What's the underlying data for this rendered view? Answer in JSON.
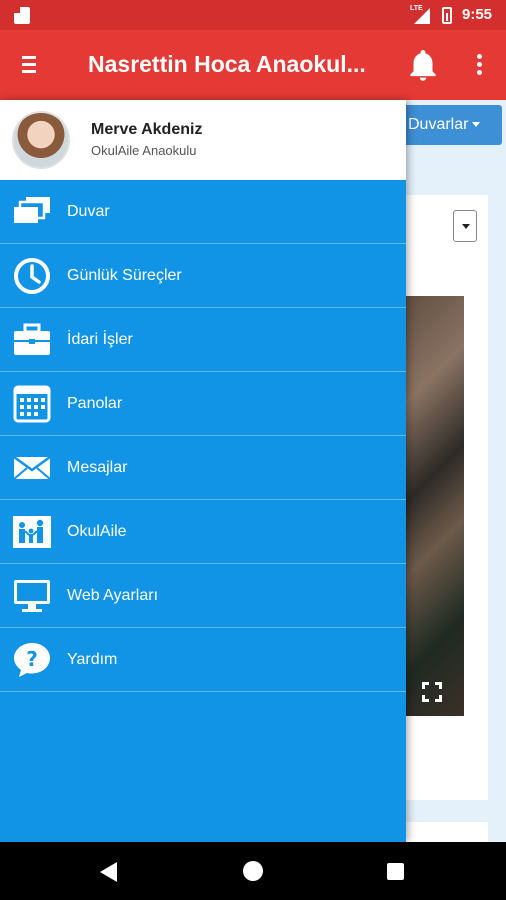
{
  "status_bar": {
    "network": "LTE",
    "time": "9:55"
  },
  "app_bar": {
    "title": "Nasrettin Hoca Anaokul..."
  },
  "content": {
    "walls_button_label": "Duvarlar"
  },
  "drawer": {
    "user_name": "Merve Akdeniz",
    "user_school": "OkulAile Anaokulu",
    "items": [
      {
        "label": "Duvar",
        "icon": "layers-icon"
      },
      {
        "label": "Günlük Süreçler",
        "icon": "clock-icon"
      },
      {
        "label": "İdari İşler",
        "icon": "briefcase-icon"
      },
      {
        "label": "Panolar",
        "icon": "calendar-icon"
      },
      {
        "label": "Mesajlar",
        "icon": "envelope-icon"
      },
      {
        "label": "OkulAile",
        "icon": "family-icon"
      },
      {
        "label": "Web Ayarları",
        "icon": "monitor-icon"
      },
      {
        "label": "Yardım",
        "icon": "help-icon"
      }
    ]
  },
  "colors": {
    "status_bar": "#d32f2f",
    "app_bar": "#e53935",
    "drawer": "#1194e6",
    "walls_button": "#3d8fd6"
  }
}
